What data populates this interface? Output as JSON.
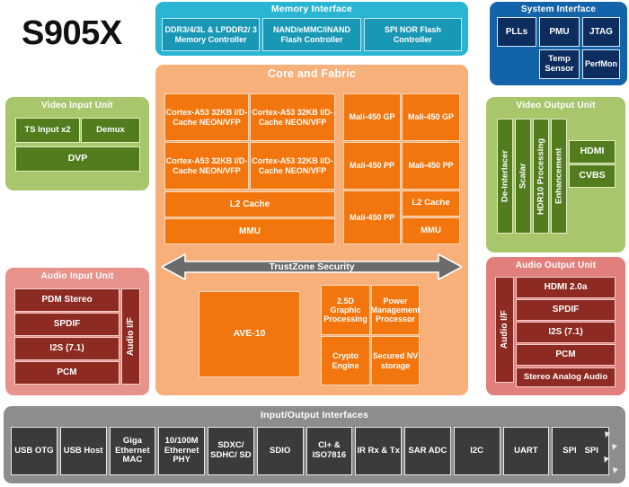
{
  "chip": {
    "name": "S905X"
  },
  "memory_interface": {
    "title": "Memory Interface",
    "color": "#2ab6d2",
    "blocks": [
      "DDR3/4/3L & LPDDR2/ 3 Memory Controller",
      "NAND/eMMC/iNAND Flash Controller",
      "SPI NOR Flash Controller"
    ]
  },
  "system_interface": {
    "title": "System Interface",
    "color": "#1263aa",
    "blocks": [
      "PLLs",
      "PMU",
      "JTAG",
      "Temp Sensor",
      "PerfMon"
    ]
  },
  "core_fabric": {
    "title": "Core and Fabric",
    "color": "#f7b07a",
    "cpu": [
      "Cortex-A53 32KB I/D-Cache NEON/VFP",
      "Cortex-A53 32KB I/D-Cache NEON/VFP",
      "Cortex-A53 32KB I/D-Cache NEON/VFP",
      "Cortex-A53 32KB I/D-Cache NEON/VFP"
    ],
    "cpu_l2": "L2 Cache",
    "cpu_mmu": "MMU",
    "gpu": [
      "Mali-450 GP",
      "Mali-450 GP",
      "Mali-450 PP",
      "Mali-450 PP",
      "Mali-450 PP"
    ],
    "gpu_l2": "L2 Cache",
    "gpu_mmu": "MMU",
    "trustzone": "TrustZone Security",
    "ave": "AVE-10",
    "misc": [
      "2.5D Graphic Processing",
      "Power Management Processor",
      "Crypto Engine",
      "Secured NV storage"
    ]
  },
  "video_input": {
    "title": "Video Input Unit",
    "color": "#a8c76d",
    "blocks": [
      "TS Input x2",
      "Demux",
      "DVP"
    ]
  },
  "video_output": {
    "title": "Video Output Unit",
    "color": "#a8c76d",
    "pipeline": [
      "De-Interlacer",
      "Scalar",
      "HDR10 Processing",
      "Enhancement"
    ],
    "outputs": [
      "HDMI",
      "CVBS"
    ]
  },
  "audio_input": {
    "title": "Audio Input Unit",
    "color": "#e8928c",
    "interface_label": "Audio I/F",
    "blocks": [
      "PDM Stereo",
      "SPDIF",
      "I2S (7.1)",
      "PCM"
    ]
  },
  "audio_output": {
    "title": "Audio Output Unit",
    "color": "#e07f7c",
    "interface_label": "Audio I/F",
    "blocks": [
      "HDMI 2.0a",
      "SPDIF",
      "I2S (7.1)",
      "PCM",
      "Stereo Analog Audio"
    ]
  },
  "io_interfaces": {
    "title": "Input/Output Interfaces",
    "color": "#8d8d8d",
    "blocks": [
      "USB OTG",
      "USB Host",
      "Giga Ethernet MAC",
      "10/100M Ethernet PHY",
      "SDXC/ SDHC/ SD",
      "SDIO",
      "CI+ & ISO7816",
      "IR Rx & Tx",
      "SAR ADC",
      "I2C",
      "UART"
    ],
    "spi_a": "SPI",
    "spi_b": "SPI"
  }
}
